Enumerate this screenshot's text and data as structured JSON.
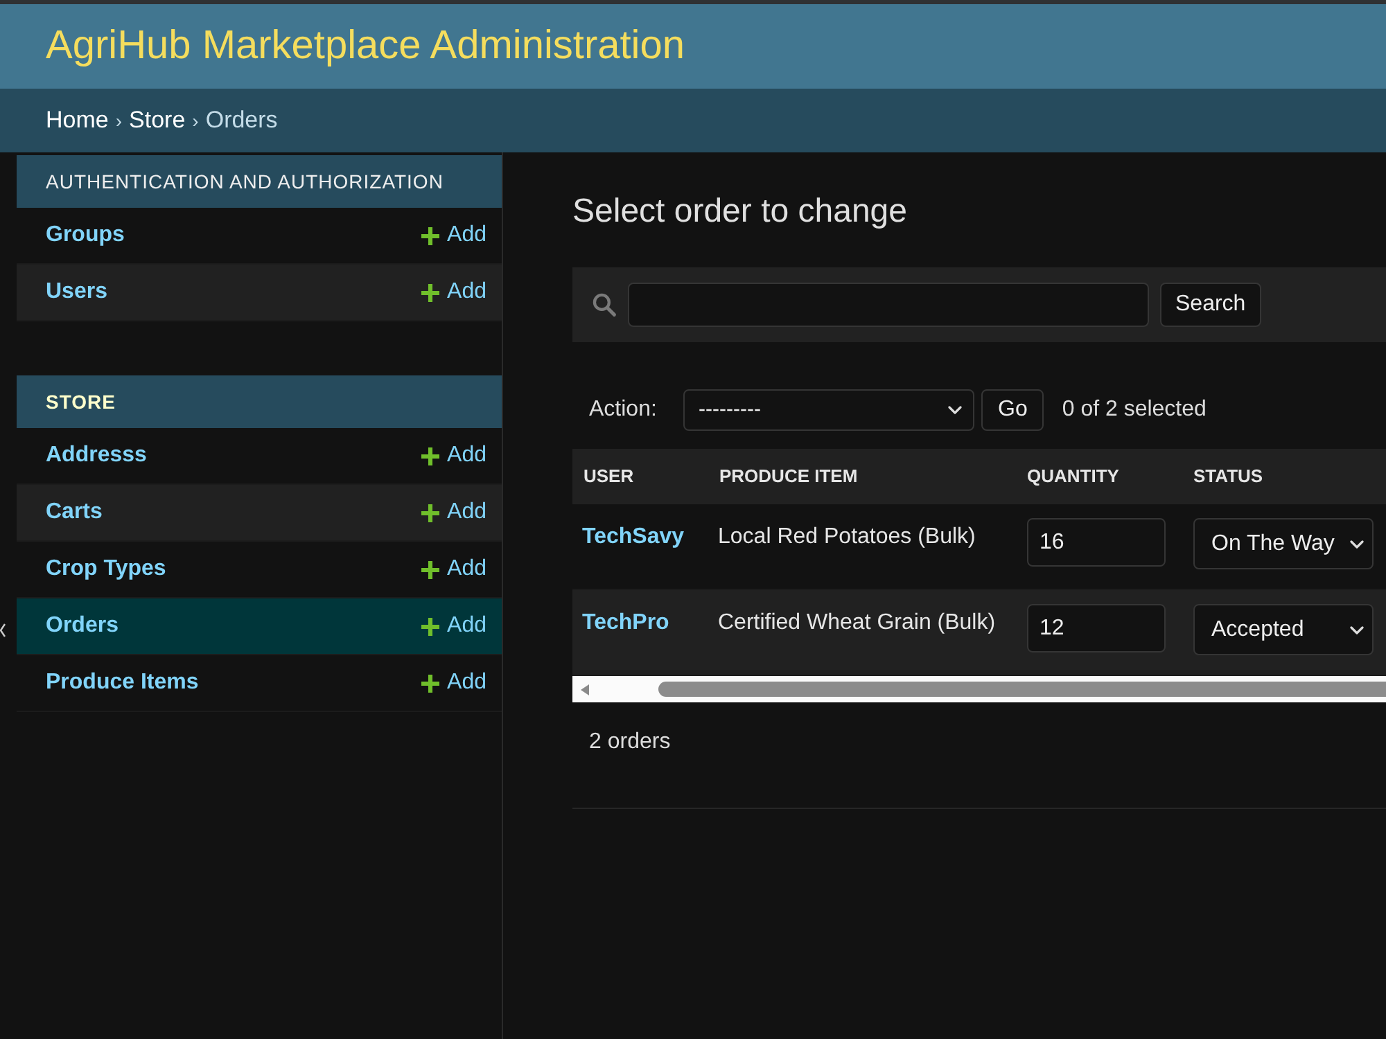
{
  "header": {
    "title": "AgriHub Marketplace Administration"
  },
  "breadcrumbs": [
    {
      "kind": "link",
      "label": "Home"
    },
    {
      "kind": "separator",
      "label": "›"
    },
    {
      "kind": "link",
      "label": "Store"
    },
    {
      "kind": "separator",
      "label": "›"
    },
    {
      "kind": "current",
      "label": "Orders"
    }
  ],
  "sidebar": {
    "modules": [
      {
        "caption": "AUTHENTICATION AND AUTHORIZATION",
        "current": false,
        "models": [
          {
            "name": "Groups",
            "add_label": "Add",
            "selected": false
          },
          {
            "name": "Users",
            "add_label": "Add",
            "selected": false
          }
        ]
      },
      {
        "caption": "STORE",
        "current": true,
        "models": [
          {
            "name": "Addresss",
            "add_label": "Add",
            "selected": false
          },
          {
            "name": "Carts",
            "add_label": "Add",
            "selected": false
          },
          {
            "name": "Crop Types",
            "add_label": "Add",
            "selected": false
          },
          {
            "name": "Orders",
            "add_label": "Add",
            "selected": true
          },
          {
            "name": "Produce Items",
            "add_label": "Add",
            "selected": false
          }
        ]
      }
    ]
  },
  "content": {
    "title": "Select order to change",
    "search": {
      "button": "Search"
    },
    "actions": {
      "label": "Action:",
      "value": "---------",
      "button": "Go",
      "counter": "0 of 2 selected"
    },
    "table": {
      "columns": [
        "USER",
        "PRODUCE ITEM",
        "QUANTITY",
        "STATUS"
      ],
      "rows": [
        {
          "user": "TechSavy",
          "produce_item": "Local Red Potatoes (Bulk)",
          "quantity": "16",
          "status": "On The Way"
        },
        {
          "user": "TechPro",
          "produce_item": "Certified Wheat Grain (Bulk)",
          "quantity": "12",
          "status": "Accepted"
        }
      ]
    },
    "paginator": "2 orders"
  }
}
